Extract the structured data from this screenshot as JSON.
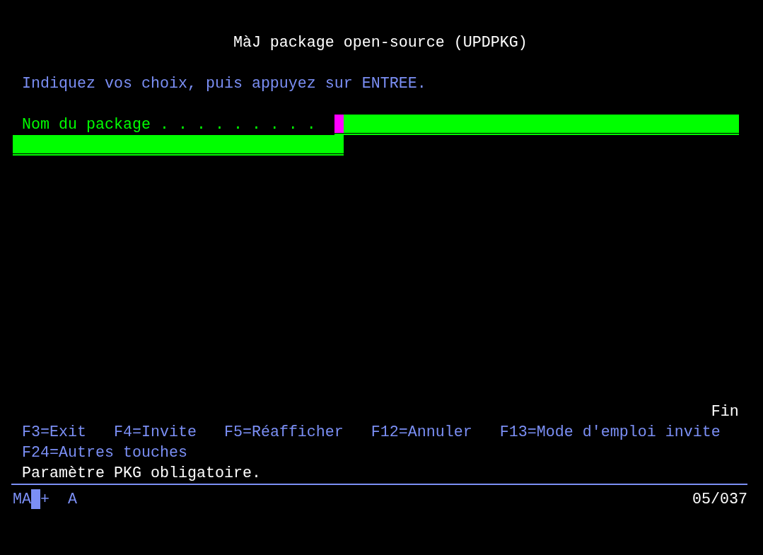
{
  "title": "MàJ package open-source (UPDPKG)",
  "instruction": "Indiquez vos choix, puis appuyez sur ENTREE.",
  "fields": [
    {
      "label": "Nom du package . . . . . . . . .",
      "focused": true
    }
  ],
  "more_indicator": "Fin",
  "function_keys": [
    [
      "F3=Exit",
      "F4=Invite",
      "F5=Réafficher",
      "F12=Annuler",
      "F13=Mode d'emploi invite"
    ],
    [
      "F24=Autres touches"
    ]
  ],
  "message": "Paramètre PKG obligatoire.",
  "status_bar": {
    "mode": "MA",
    "indicator": "+",
    "keyboard": "A",
    "cursor_position": "05/037"
  }
}
